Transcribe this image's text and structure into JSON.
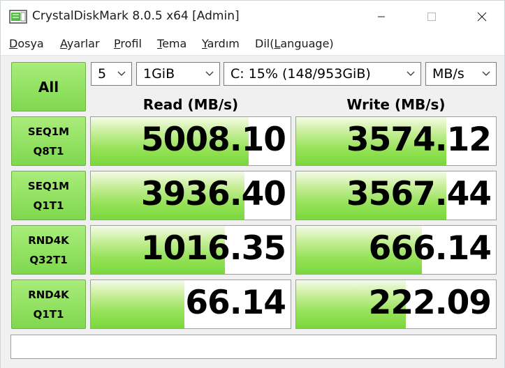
{
  "window": {
    "title": "CrystalDiskMark 8.0.5 x64 [Admin]"
  },
  "menu": [
    {
      "first": "D",
      "rest": "osya"
    },
    {
      "first": "A",
      "rest": "yarlar"
    },
    {
      "first": "P",
      "rest": "rofil"
    },
    {
      "first": "T",
      "rest": "ema"
    },
    {
      "first": "Y",
      "rest": "ardım"
    },
    {
      "pre": "Dil(",
      "first": "L",
      "rest": "anguage)"
    }
  ],
  "controls": {
    "all_label": "All",
    "count": "5",
    "size": "1GiB",
    "drive": "C: 15% (148/953GiB)",
    "unit": "MB/s"
  },
  "columns": {
    "read": "Read (MB/s)",
    "write": "Write (MB/s)"
  },
  "colors": {
    "accent_green": "#7bd73e"
  },
  "rows": [
    {
      "line1": "SEQ1M",
      "line2": "Q8T1",
      "read": "5008.10",
      "write": "3574.12",
      "read_fill": 0.79,
      "write_fill": 0.75
    },
    {
      "line1": "SEQ1M",
      "line2": "Q1T1",
      "read": "3936.40",
      "write": "3567.44",
      "read_fill": 0.77,
      "write_fill": 0.75
    },
    {
      "line1": "RND4K",
      "line2": "Q32T1",
      "read": "1016.35",
      "write": "666.14",
      "read_fill": 0.67,
      "write_fill": 0.63
    },
    {
      "line1": "RND4K",
      "line2": "Q1T1",
      "read": "66.14",
      "write": "222.09",
      "read_fill": 0.47,
      "write_fill": 0.55
    }
  ],
  "comment": ""
}
